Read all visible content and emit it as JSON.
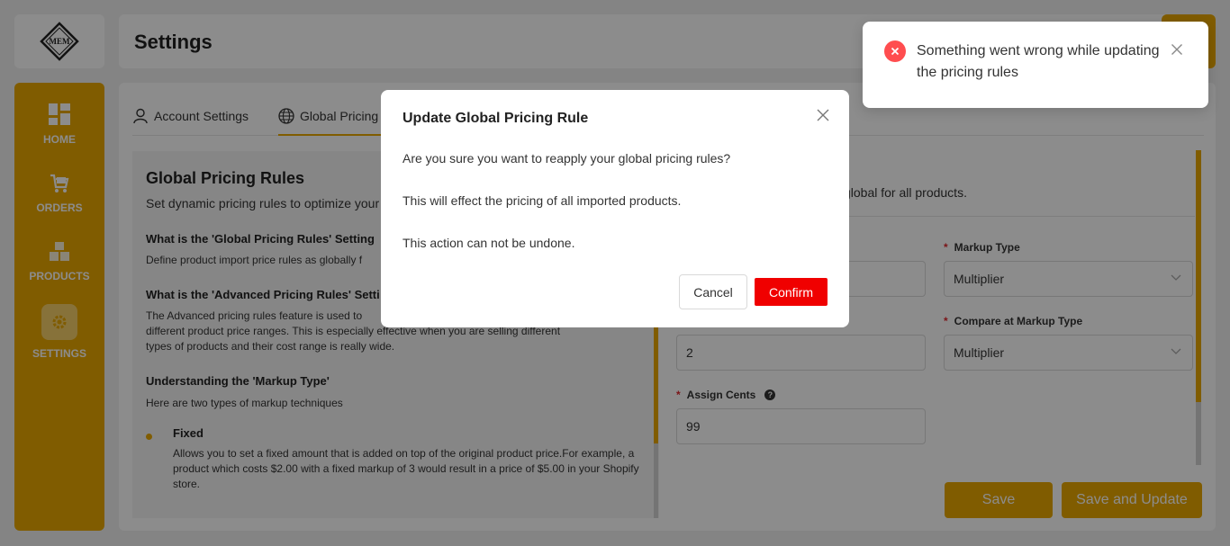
{
  "app": {
    "logo_text": "MEM"
  },
  "header": {
    "title": "Settings"
  },
  "sidebar": {
    "items": [
      {
        "label": "HOME",
        "icon": "dashboard-icon"
      },
      {
        "label": "ORDERS",
        "icon": "cart-icon"
      },
      {
        "label": "PRODUCTS",
        "icon": "boxes-icon"
      },
      {
        "label": "SETTINGS",
        "icon": "gear-icon",
        "active": true
      }
    ]
  },
  "tabs": [
    {
      "label": "Account Settings",
      "icon": "user-icon"
    },
    {
      "label": "Global Pricing",
      "icon": "globe-icon",
      "active": true
    }
  ],
  "info": {
    "title": "Global Pricing Rules",
    "subtitle": "Set dynamic pricing rules to optimize your",
    "q1": "What is the 'Global Pricing Rules' Setting",
    "a1": "Define product import price rules as globally f",
    "q2": "What is the 'Advanced Pricing Rules' Setti",
    "a2_line1": "The Advanced pricing rules feature is used to",
    "a2_line2": "different product price ranges. This is especially effective when you are selling different",
    "a2_line3": "types of products and their cost range is really wide.",
    "q3": "Understanding the 'Markup Type'",
    "a3": "Here are two types of markup techniques",
    "fixed_title": "Fixed",
    "fixed_desc": "Allows you to set a fixed amount that is added on top of the original product price.For example, a product which costs $2.00 with a fixed markup of 3 would result in a price of $5.00 in your Shopify store."
  },
  "form": {
    "description": "global for all products.",
    "markup_type_label": "Markup Type",
    "markup_type_value": "Multiplier",
    "compare_markup_value": "2",
    "compare_markup_type_label": "Compare at Markup Type",
    "compare_markup_type_value": "Multiplier",
    "assign_cents_label": "Assign Cents",
    "assign_cents_value": "99",
    "save_label": "Save",
    "save_update_label": "Save and Update"
  },
  "modal": {
    "title": "Update Global Pricing Rule",
    "line1": "Are you sure you want to reapply your global pricing rules?",
    "line2": "This will effect the pricing of all imported products.",
    "line3": "This action can not be undone.",
    "cancel_label": "Cancel",
    "confirm_label": "Confirm"
  },
  "toast": {
    "message": "Something went wrong while updating the pricing rules",
    "type": "error"
  },
  "colors": {
    "accent": "#e9a800",
    "danger": "#f00000",
    "error_icon": "#ff4d4f"
  }
}
